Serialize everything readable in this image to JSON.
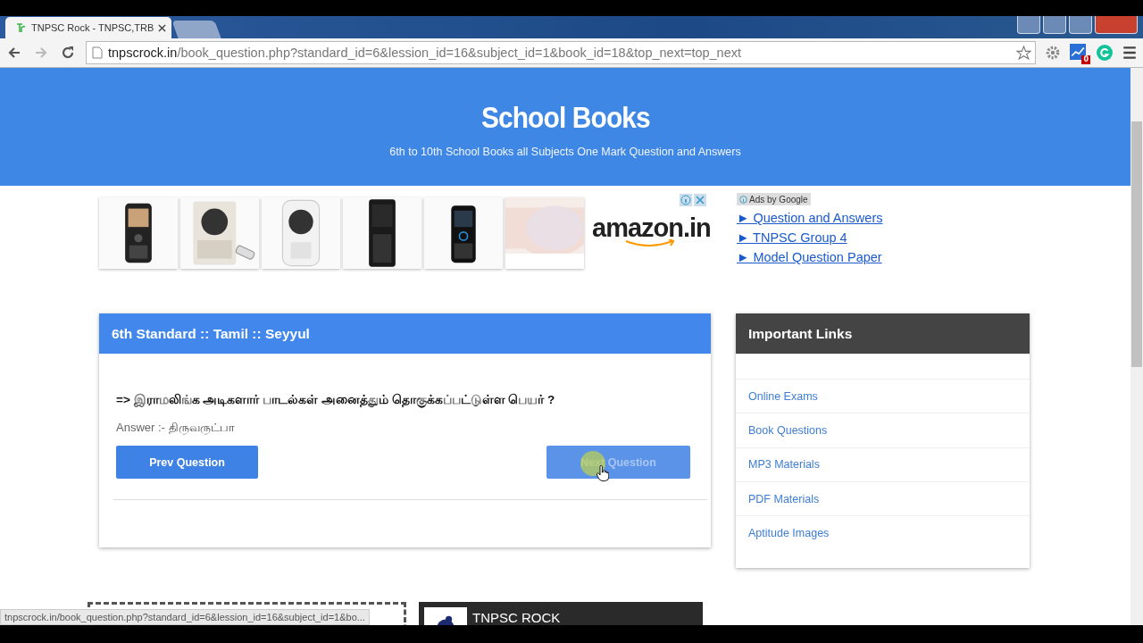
{
  "browser": {
    "tabs": [
      {
        "title": "TNPSC Rock - TNPSC,TRB",
        "selected": true
      },
      {
        "selected": false
      }
    ],
    "address": {
      "host": "tnpscrock.in",
      "path": "/book_question.php?standard_id=6&lession_id=16&subject_id=1&book_id=18&top_next=top_next"
    },
    "extension_badge": "0"
  },
  "header": {
    "title": "School Books",
    "subtitle": "6th to 10th School Books all Subjects One Mark Question and Answers"
  },
  "ads": {
    "brand": "amazon.in",
    "ads_label": "Ads by Google",
    "links": [
      "► Question and Answers",
      "► TNPSC Group 4",
      "► Model Question Paper"
    ]
  },
  "question_card": {
    "title": "6th Standard :: Tamil :: Seyyul",
    "question": "=> இராமலிங்க அடிகளார் பாடல்கள் அனைத்தும் தொகுக்கப்பட்டுள்ள பெயர் ?",
    "answer_label": "Answer :-",
    "answer": "திருவருட்பா",
    "buttons": [
      {
        "label": "Prev Question",
        "hovered": false
      },
      {
        "label": "Next Question",
        "hovered": true
      }
    ]
  },
  "sidebar": {
    "title": "Important Links",
    "links": [
      "Online Exams",
      "Book Questions",
      "MP3 Materials",
      "PDF Materials",
      "Aptitude Images"
    ]
  },
  "footer_box": {
    "title": "TNPSC ROCK"
  },
  "status_bubble": "tnpscrock.in/book_question.php?standard_id=6&lession_id=16&subject_id=1&bo..."
}
